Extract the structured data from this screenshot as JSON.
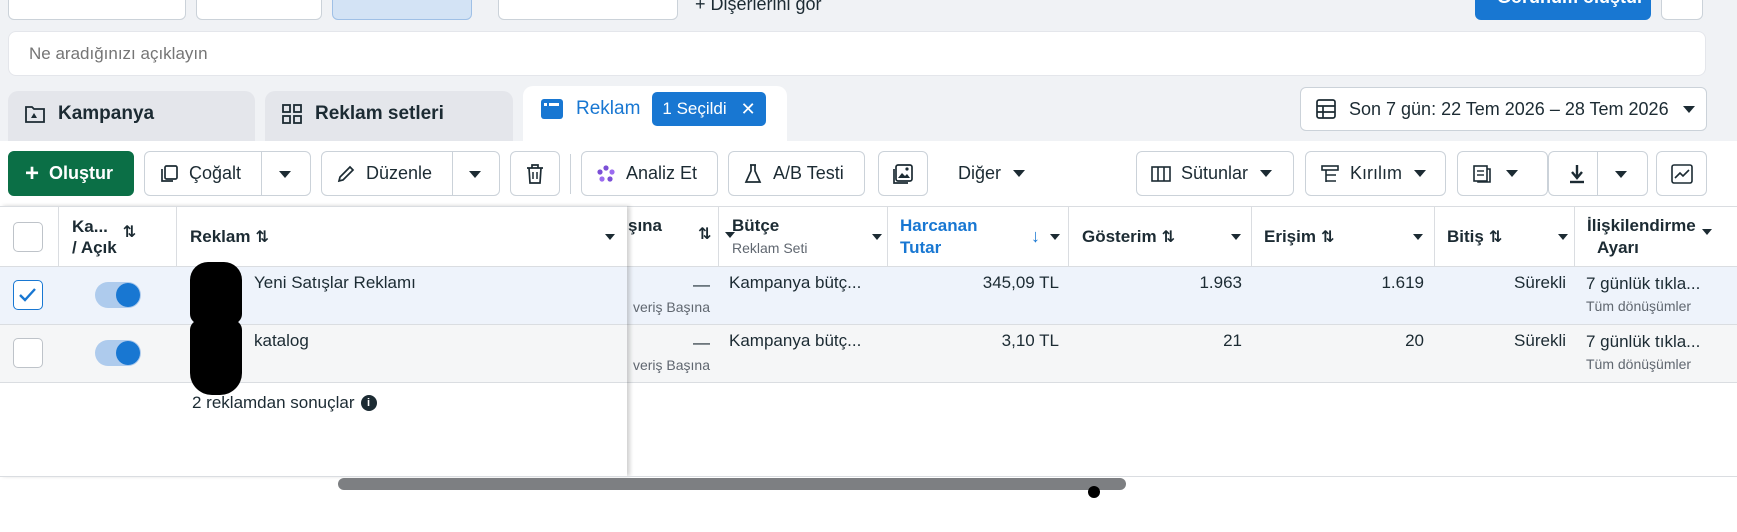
{
  "top_toolbar": {
    "insights_label": "Dişerlerini gör",
    "create_rule_label": "Görünüm oluştur"
  },
  "search": {
    "placeholder": "Ne aradığınızı açıklayın"
  },
  "tabs": [
    {
      "label": "Kampanya"
    },
    {
      "label": "Reklam setleri"
    },
    {
      "label": "Reklam",
      "badge": "1 Seçildi"
    }
  ],
  "date_range": "Son 7 gün: 22 Tem 2026 – 28 Tem 2026",
  "toolbar": {
    "create": "Oluştur",
    "duplicate": "Çoğalt",
    "edit": "Düzenle",
    "analyze": "Analiz Et",
    "ab_test": "A/B Testi",
    "more": "Diğer",
    "columns": "Sütunlar",
    "breakdown": "Kırılım"
  },
  "table": {
    "headers": {
      "toggle": [
        "Ka...",
        "/ Açık"
      ],
      "ad": "Reklam",
      "result_cost": "şına",
      "budget": "Bütçe",
      "budget_sub": "Reklam Seti",
      "spent": [
        "Harcanan",
        "Tutar"
      ],
      "impressions": "Gösterim",
      "reach": "Erişim",
      "end": "Bitiş",
      "attribution": [
        "İlişkilendirme",
        "Ayarı"
      ]
    },
    "rows": [
      {
        "name": "Yeni Satışlar Reklamı",
        "cost_value": "—",
        "cost_sub": "veriş Başına",
        "budget": "Kampanya bütç...",
        "spent": "345,09 TL",
        "impressions": "1.963",
        "reach": "1.619",
        "end": "Sürekli",
        "attribution": "7 günlük tıkla...",
        "attribution_sub": "Tüm dönüşümler",
        "checked": true
      },
      {
        "name": "katalog",
        "cost_value": "—",
        "cost_sub": "veriş Başına",
        "budget": "Kampanya bütç...",
        "spent": "3,10 TL",
        "impressions": "21",
        "reach": "20",
        "end": "Sürekli",
        "attribution": "7 günlük tıkla...",
        "attribution_sub": "Tüm dönüşümler",
        "checked": false
      }
    ],
    "summary": "2 reklamdan sonuçlar"
  },
  "colors": {
    "accent": "#1877d2",
    "create": "#0b6f46"
  }
}
